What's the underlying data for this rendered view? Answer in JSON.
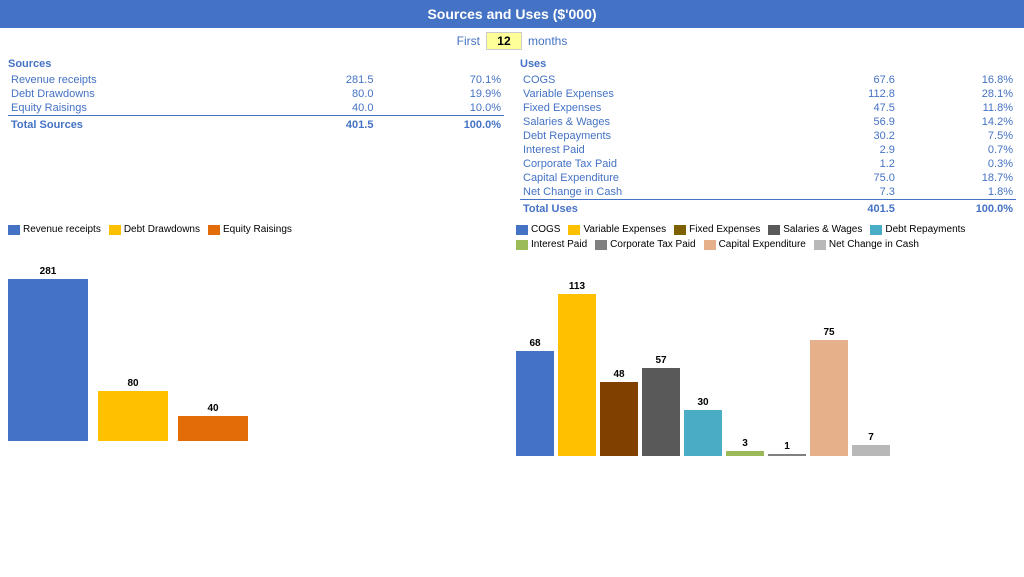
{
  "title": "Sources and Uses ($'000)",
  "months_label_first": "First",
  "months_value": "12",
  "months_label_months": "months",
  "sources": {
    "header": "Sources",
    "items": [
      {
        "label": "Revenue receipts",
        "value": "281.5",
        "pct": "70.1%"
      },
      {
        "label": "Debt Drawdowns",
        "value": "80.0",
        "pct": "19.9%"
      },
      {
        "label": "Equity Raisings",
        "value": "40.0",
        "pct": "10.0%"
      }
    ],
    "total_label": "Total Sources",
    "total_value": "401.5",
    "total_pct": "100.0%"
  },
  "uses": {
    "header": "Uses",
    "items": [
      {
        "label": "COGS",
        "value": "67.6",
        "pct": "16.8%"
      },
      {
        "label": "Variable Expenses",
        "value": "112.8",
        "pct": "28.1%"
      },
      {
        "label": "Fixed Expenses",
        "value": "47.5",
        "pct": "11.8%"
      },
      {
        "label": "Salaries & Wages",
        "value": "56.9",
        "pct": "14.2%"
      },
      {
        "label": "Debt Repayments",
        "value": "30.2",
        "pct": "7.5%"
      },
      {
        "label": "Interest Paid",
        "value": "2.9",
        "pct": "0.7%"
      },
      {
        "label": "Corporate Tax Paid",
        "value": "1.2",
        "pct": "0.3%"
      },
      {
        "label": "Capital Expenditure",
        "value": "75.0",
        "pct": "18.7%"
      },
      {
        "label": "Net Change in Cash",
        "value": "7.3",
        "pct": "1.8%"
      }
    ],
    "total_label": "Total Uses",
    "total_value": "401.5",
    "total_pct": "100.0%"
  },
  "left_legend": [
    {
      "label": "Revenue receipts",
      "color": "#4472C4"
    },
    {
      "label": "Debt Drawdowns",
      "color": "#FFC000"
    },
    {
      "label": "Equity Raisings",
      "color": "#E36C09"
    }
  ],
  "right_legend": [
    {
      "label": "COGS",
      "color": "#4472C4"
    },
    {
      "label": "Variable Expenses",
      "color": "#FFC000"
    },
    {
      "label": "Fixed Expenses",
      "color": "#7F6000"
    },
    {
      "label": "Salaries & Wages",
      "color": "#595959"
    },
    {
      "label": "Debt Repayments",
      "color": "#4BACC6"
    },
    {
      "label": "Interest Paid",
      "color": "#9BBB59"
    },
    {
      "label": "Corporate Tax Paid",
      "color": "#808080"
    },
    {
      "label": "Capital Expenditure",
      "color": "#E6B08A"
    },
    {
      "label": "Net Change in Cash",
      "color": "#B8B8B8"
    }
  ],
  "left_bars": [
    {
      "label": "281",
      "value": 281,
      "color": "#4472C4",
      "max": 281
    },
    {
      "label": "80",
      "value": 80,
      "color": "#FFC000",
      "max": 281
    },
    {
      "label": "40",
      "value": 40,
      "color": "#E36C09",
      "max": 281
    }
  ],
  "right_bars": [
    {
      "label": "68",
      "value": 68,
      "color": "#4472C4"
    },
    {
      "label": "113",
      "value": 113,
      "color": "#FFC000"
    },
    {
      "label": "48",
      "value": 48,
      "color": "#7F4000"
    },
    {
      "label": "57",
      "value": 57,
      "color": "#595959"
    },
    {
      "label": "30",
      "value": 30,
      "color": "#4BACC6"
    },
    {
      "label": "3",
      "value": 3,
      "color": "#9BBB59"
    },
    {
      "label": "1",
      "value": 1,
      "color": "#808080"
    },
    {
      "label": "75",
      "value": 75,
      "color": "#E6B08A"
    },
    {
      "label": "7",
      "value": 7,
      "color": "#B8B8B8"
    }
  ],
  "chart_max": 113
}
